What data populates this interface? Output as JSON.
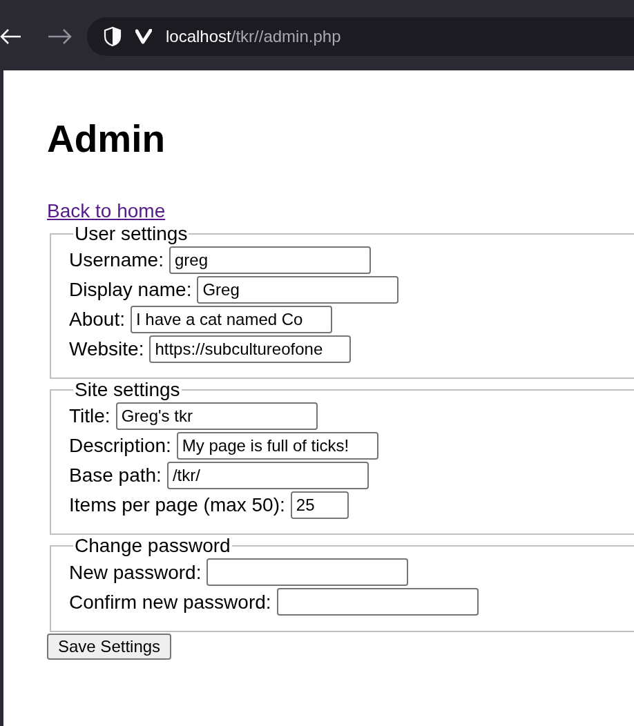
{
  "browser": {
    "url_host": "localhost",
    "url_path": "/tkr//admin.php"
  },
  "page": {
    "heading": "Admin",
    "back_link": "Back to home",
    "fieldsets": [
      {
        "legend": "User settings",
        "fields": [
          {
            "label": "Username:",
            "kind": "text",
            "value": "greg"
          },
          {
            "label": "Display name:",
            "kind": "text",
            "value": "Greg"
          },
          {
            "label": "About:",
            "kind": "text",
            "value": "I have a cat named Co"
          },
          {
            "label": "Website:",
            "kind": "text",
            "value": "https://subcultureofone"
          }
        ]
      },
      {
        "legend": "Site settings",
        "fields": [
          {
            "label": "Title:",
            "kind": "text",
            "value": "Greg's tkr"
          },
          {
            "label": "Description:",
            "kind": "text",
            "value": "My page is full of ticks!"
          },
          {
            "label": "Base path:",
            "kind": "text",
            "value": "/tkr/"
          },
          {
            "label": "Items per page (max 50):",
            "kind": "number",
            "value": "25"
          }
        ]
      },
      {
        "legend": "Change password",
        "fields": [
          {
            "label": "New password:",
            "kind": "password"
          },
          {
            "label": "Confirm new password:",
            "kind": "password"
          }
        ]
      }
    ],
    "save_button": "Save Settings"
  }
}
